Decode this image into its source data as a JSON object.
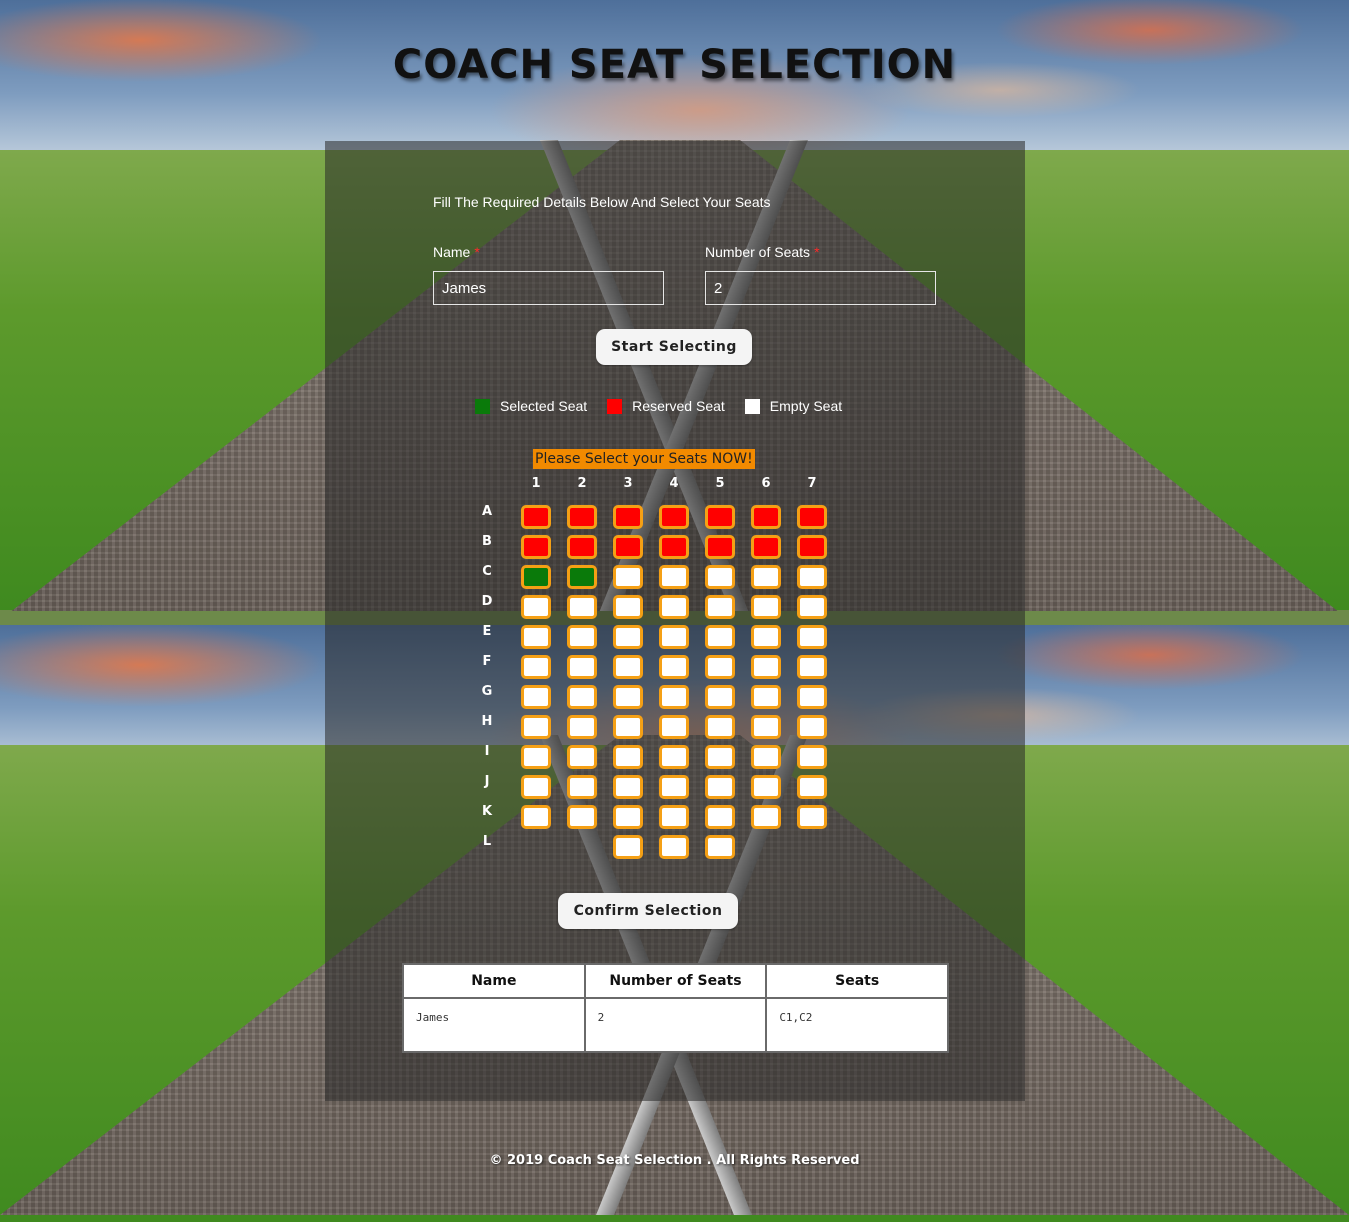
{
  "page": {
    "title": "COACH SEAT SELECTION",
    "footer": "© 2019 Coach Seat Selection . All Rights Reserved"
  },
  "form": {
    "intro": "Fill The Required Details Below And Select Your Seats",
    "name_label": "Name",
    "seats_label": "Number of Seats",
    "required_mark": "*",
    "name_value": "James",
    "seats_value": "2",
    "start_button": "Start Selecting"
  },
  "legend": {
    "selected": "Selected Seat",
    "reserved": "Reserved Seat",
    "empty": "Empty Seat"
  },
  "colors": {
    "selected": "#0a7a0a",
    "reserved": "#ff0000",
    "empty": "#ffffff",
    "seat_border": "#f5a015",
    "notice_bg": "#f28a00"
  },
  "seat_map": {
    "notice": "Please Select your Seats NOW!",
    "columns": [
      "1",
      "2",
      "3",
      "4",
      "5",
      "6",
      "7"
    ],
    "rows": [
      {
        "letter": "A",
        "seats": [
          "reserved",
          "reserved",
          "reserved",
          "reserved",
          "reserved",
          "reserved",
          "reserved"
        ]
      },
      {
        "letter": "B",
        "seats": [
          "reserved",
          "reserved",
          "reserved",
          "reserved",
          "reserved",
          "reserved",
          "reserved"
        ]
      },
      {
        "letter": "C",
        "seats": [
          "selected",
          "selected",
          "empty",
          "empty",
          "empty",
          "empty",
          "empty"
        ]
      },
      {
        "letter": "D",
        "seats": [
          "empty",
          "empty",
          "empty",
          "empty",
          "empty",
          "empty",
          "empty"
        ]
      },
      {
        "letter": "E",
        "seats": [
          "empty",
          "empty",
          "empty",
          "empty",
          "empty",
          "empty",
          "empty"
        ]
      },
      {
        "letter": "F",
        "seats": [
          "empty",
          "empty",
          "empty",
          "empty",
          "empty",
          "empty",
          "empty"
        ]
      },
      {
        "letter": "G",
        "seats": [
          "empty",
          "empty",
          "empty",
          "empty",
          "empty",
          "empty",
          "empty"
        ]
      },
      {
        "letter": "H",
        "seats": [
          "empty",
          "empty",
          "empty",
          "empty",
          "empty",
          "empty",
          "empty"
        ]
      },
      {
        "letter": "I",
        "seats": [
          "empty",
          "empty",
          "empty",
          "empty",
          "empty",
          "empty",
          "empty"
        ]
      },
      {
        "letter": "J",
        "seats": [
          "empty",
          "empty",
          "empty",
          "empty",
          "empty",
          "empty",
          "empty"
        ]
      },
      {
        "letter": "K",
        "seats": [
          "empty",
          "empty",
          "empty",
          "empty",
          "empty",
          "empty",
          "empty"
        ]
      },
      {
        "letter": "L",
        "seats": [
          null,
          null,
          "empty",
          "empty",
          "empty",
          null,
          null
        ]
      }
    ],
    "confirm_button": "Confirm Selection"
  },
  "summary": {
    "headers": [
      "Name",
      "Number of Seats",
      "Seats"
    ],
    "row": [
      "James",
      "2",
      "C1,C2"
    ]
  }
}
